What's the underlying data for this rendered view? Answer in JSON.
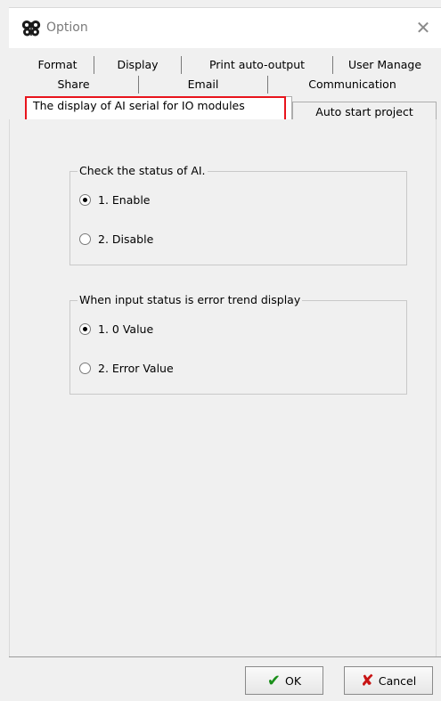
{
  "window": {
    "title": "Option",
    "close_glyph": "✕",
    "icon": "butterfly-app-icon"
  },
  "tabs": {
    "row1": [
      "Format",
      "Display",
      "Print auto-output",
      "User Manage"
    ],
    "row2": [
      "Share",
      "Email",
      "Communication"
    ],
    "row3_active": "The display of AI serial for IO modules",
    "row3_other": "Auto start project"
  },
  "highlight_color": "#e8141c",
  "group_status": {
    "title": "Check the status of AI.",
    "options": [
      "1. Enable",
      "2. Disable"
    ],
    "selected": "1. Enable"
  },
  "group_error": {
    "title": "When input status is error trend display",
    "options": [
      "1. 0 Value",
      "2. Error Value"
    ],
    "selected": "1. 0 Value"
  },
  "buttons": {
    "ok_label": "OK",
    "ok_icon": "checkmark-icon",
    "ok_color": "#1a8f1a",
    "cancel_label": "Cancel",
    "cancel_icon": "x-icon",
    "cancel_color": "#c81414"
  }
}
